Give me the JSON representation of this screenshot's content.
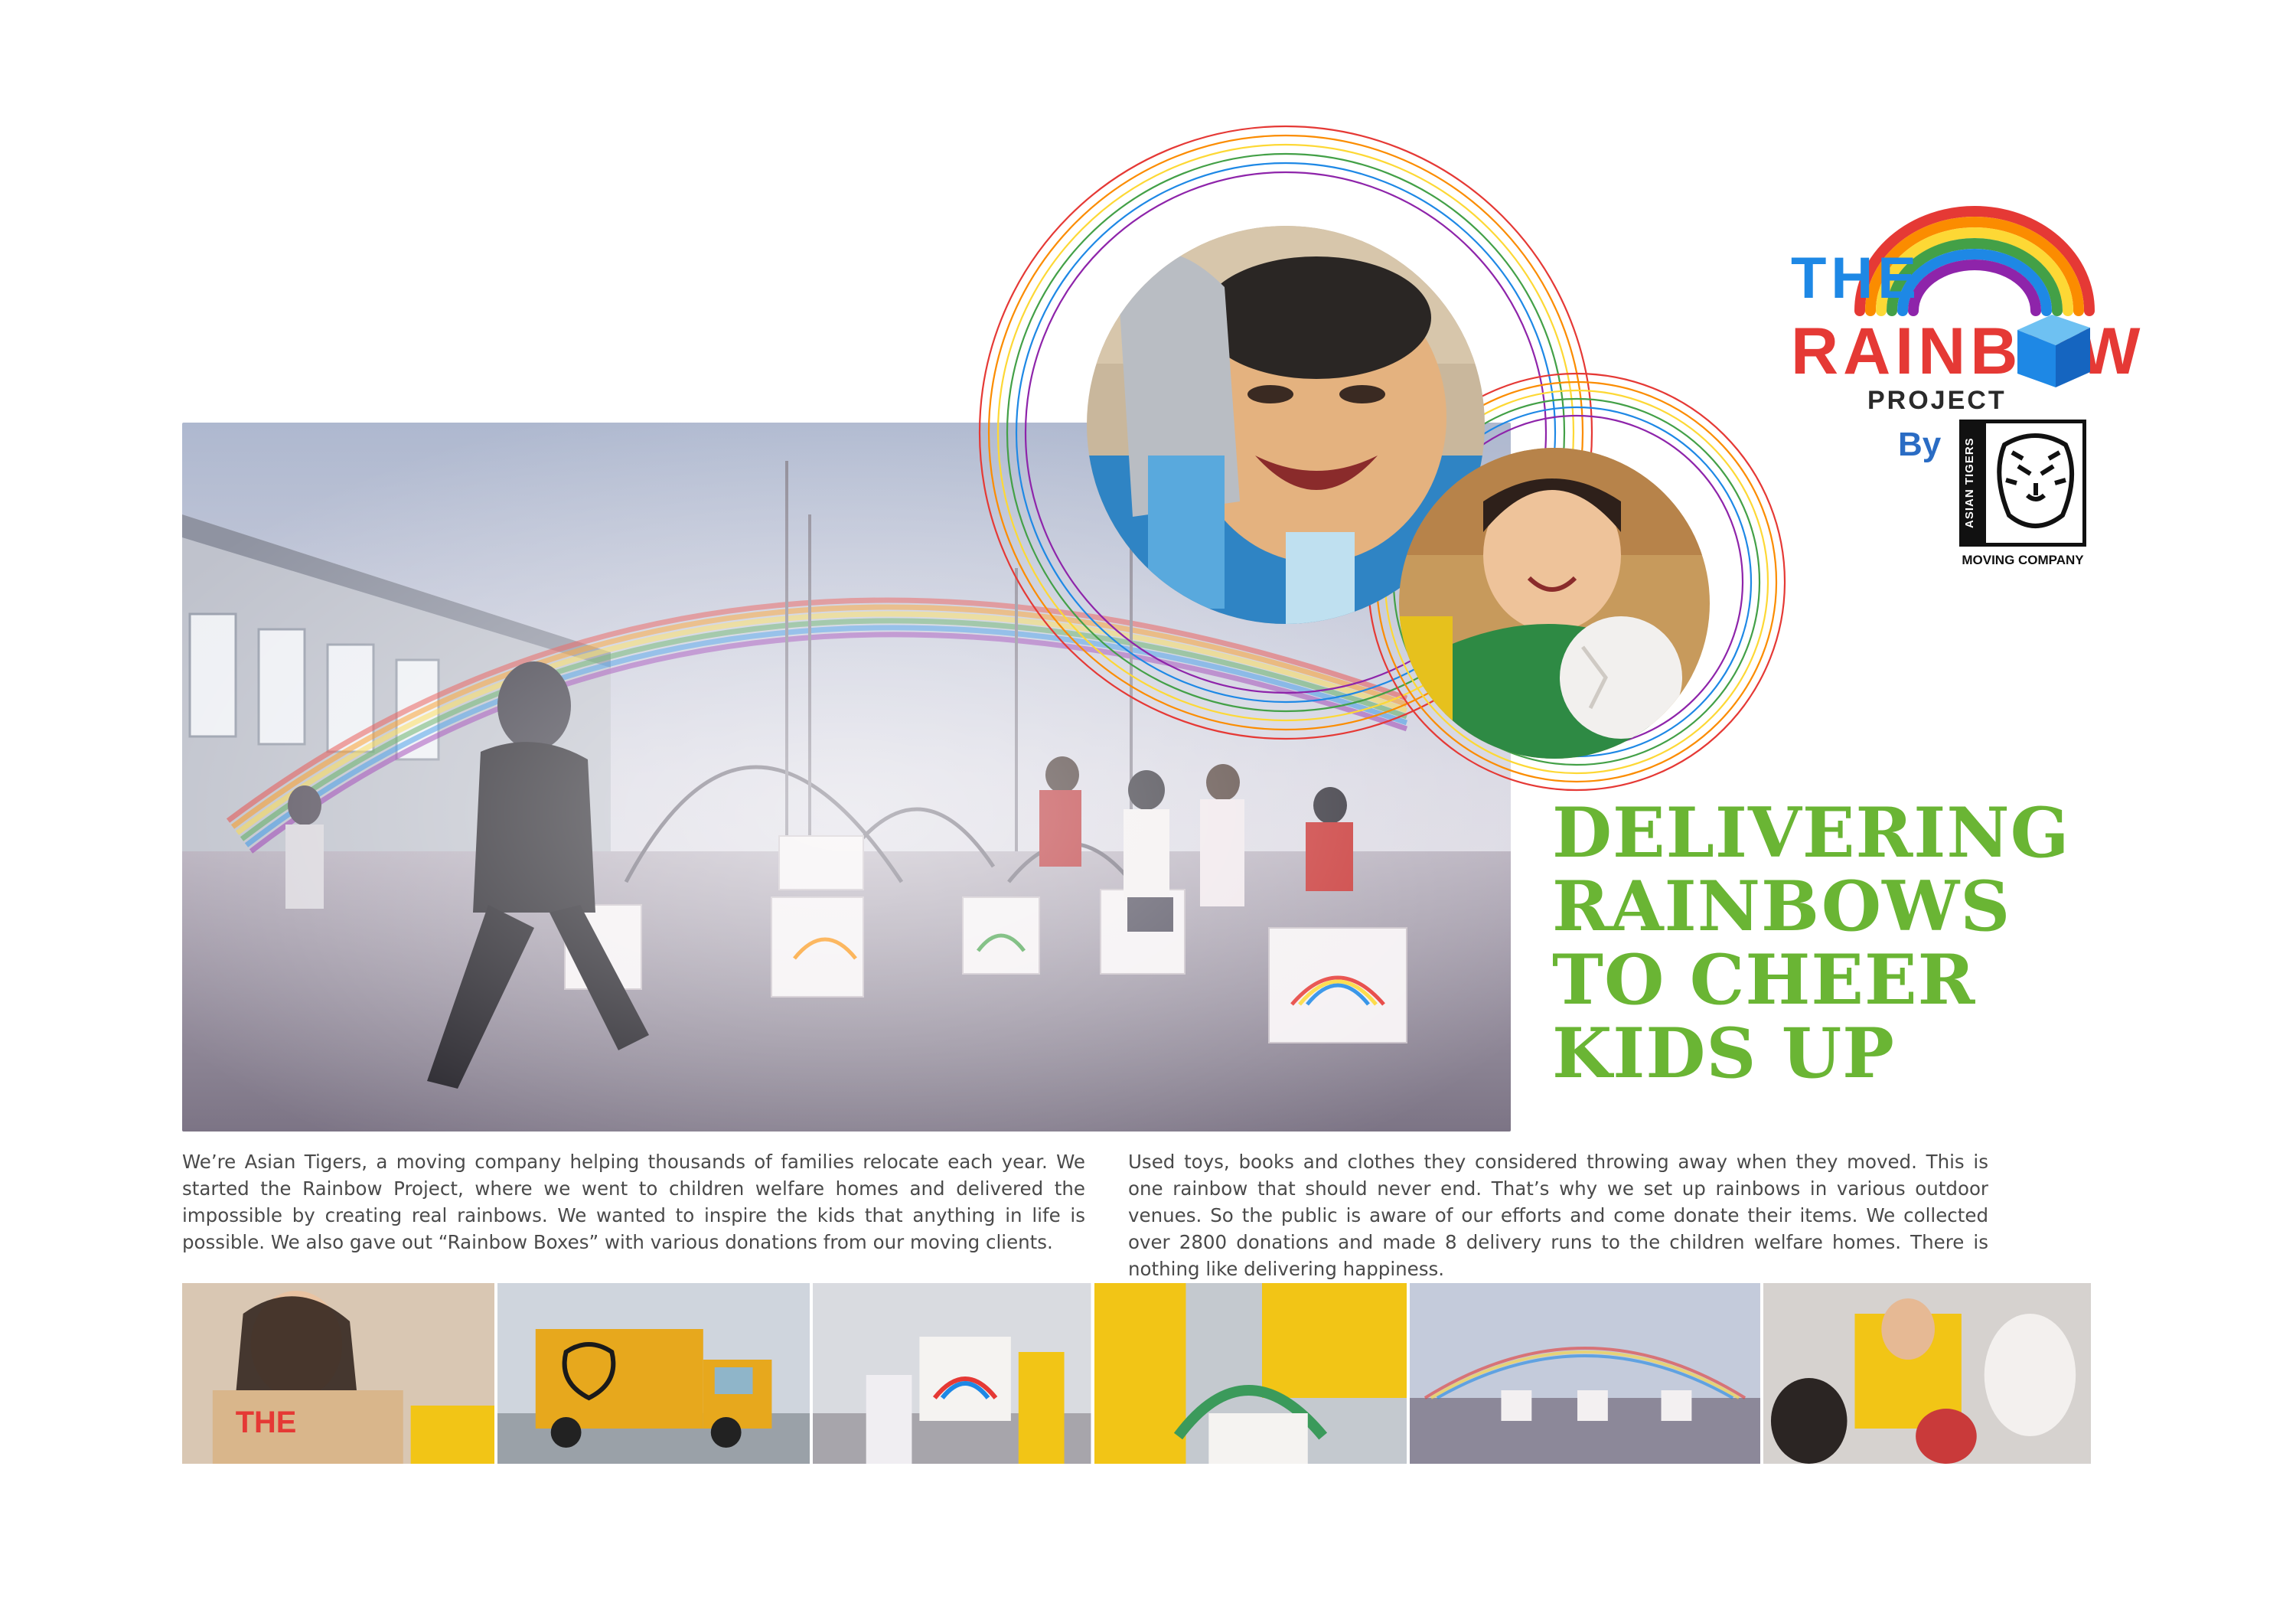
{
  "logo": {
    "title_line1": "THE",
    "title_line2": "RAINBOW",
    "title_line3": "PROJECT",
    "by": "By",
    "brand_vertical": "ASIAN TIGERS",
    "brand_sub": "MOVING COMPANY"
  },
  "headline": {
    "line1": "DELIVERING",
    "line2": "RAINBOWS",
    "line3": "TO CHEER",
    "line4": "KIDS UP"
  },
  "body": {
    "left": "We’re Asian Tigers, a moving company helping thousands of families relocate each year. We started the Rainbow Project, where we went to children welfare homes and delivered the impossible by creating real rainbows. We wanted to inspire the kids that anything in life is possible. We also gave out “Rainbow Boxes” with various donations from our moving clients.",
    "right": "Used toys, books and clothes they considered throwing away when they moved. This is one rainbow that should never end. That’s why we set up rainbows in various outdoor venues. So the public is aware of our efforts and come donate their items. We collected over 2800 donations and made 8 delivery runs to the children welfare homes. There is nothing like delivering happiness."
  },
  "colors": {
    "headline_green": "#6ab534",
    "rainbow": [
      "#e53935",
      "#fb8c00",
      "#fdd835",
      "#43a047",
      "#1e88e5",
      "#8e24aa"
    ]
  }
}
